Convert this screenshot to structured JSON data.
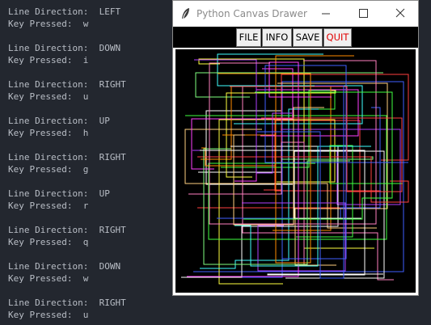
{
  "terminal": {
    "entries": [
      {
        "direction_label": "Line Direction:  LEFT",
        "key_label": "Key Pressed:  w"
      },
      {
        "direction_label": "Line Direction:  DOWN",
        "key_label": "Key Pressed:  i"
      },
      {
        "direction_label": "Line Direction:  RIGHT",
        "key_label": "Key Pressed:  u"
      },
      {
        "direction_label": "Line Direction:  UP",
        "key_label": "Key Pressed:  h"
      },
      {
        "direction_label": "Line Direction:  RIGHT",
        "key_label": "Key Pressed:  g"
      },
      {
        "direction_label": "Line Direction:  UP",
        "key_label": "Key Pressed:  r"
      },
      {
        "direction_label": "Line Direction:  RIGHT",
        "key_label": "Key Pressed:  q"
      },
      {
        "direction_label": "Line Direction:  DOWN",
        "key_label": "Key Pressed:  w"
      },
      {
        "direction_label": "Line Direction:  RIGHT",
        "key_label": "Key Pressed:  u"
      }
    ]
  },
  "window": {
    "title": "Python Canvas Drawer",
    "icon": "feather-icon",
    "controls": [
      "minimize-icon",
      "maximize-icon",
      "close-icon"
    ]
  },
  "toolbar": {
    "file_label": "FILE",
    "info_label": "INFO",
    "save_label": "SAVE",
    "quit_label": "QUIT",
    "quit_color": "#e00000"
  },
  "canvas": {
    "background": "#000000",
    "line_colors": [
      "#ffffff",
      "#ff4040",
      "#40ff40",
      "#4060ff",
      "#ffff40",
      "#ff40ff",
      "#40ffff",
      "#ff8c00",
      "#b040ff",
      "#80ff80",
      "#ff80c0",
      "#ffd080"
    ]
  }
}
